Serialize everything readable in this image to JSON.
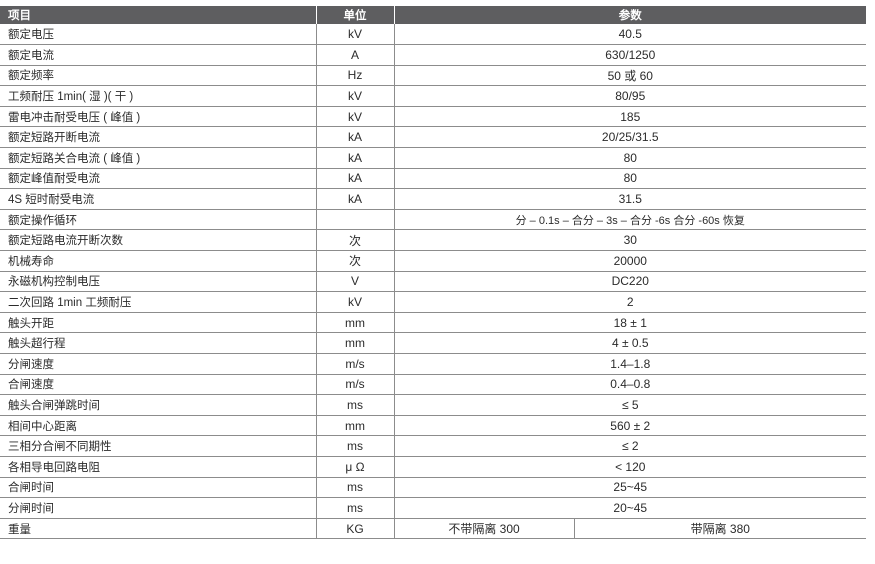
{
  "header": {
    "item": "项目",
    "unit": "单位",
    "param": "参数"
  },
  "rows": [
    {
      "item": "额定电压",
      "unit": "kV",
      "value": "40.5"
    },
    {
      "item": "额定电流",
      "unit": "A",
      "value": "630/1250"
    },
    {
      "item": "额定频率",
      "unit": "Hz",
      "value": "50 或 60"
    },
    {
      "item": "工频耐压 1min( 湿 )( 干 )",
      "unit": "kV",
      "value": "80/95"
    },
    {
      "item": "雷电冲击耐受电压 ( 峰值 )",
      "unit": "kV",
      "value": "185"
    },
    {
      "item": "额定短路开断电流",
      "unit": "kA",
      "value": "20/25/31.5"
    },
    {
      "item": "额定短路关合电流 ( 峰值 )",
      "unit": "kA",
      "value": "80"
    },
    {
      "item": "额定峰值耐受电流",
      "unit": "kA",
      "value": "80"
    },
    {
      "item": "4S 短时耐受电流",
      "unit": "kA",
      "value": "31.5"
    },
    {
      "item": "额定操作循环",
      "unit": "",
      "value": "分 – 0.1s – 合分 – 3s – 合分 -6s 合分 -60s 恢复"
    },
    {
      "item": "额定短路电流开断次数",
      "unit": "次",
      "value": "30"
    },
    {
      "item": "机械寿命",
      "unit": "次",
      "value": "20000"
    },
    {
      "item": "永磁机构控制电压",
      "unit": "V",
      "value": "DC220"
    },
    {
      "item": "二次回路 1min 工频耐压",
      "unit": "kV",
      "value": "2"
    },
    {
      "item": "触头开距",
      "unit": "mm",
      "value": "18 ± 1"
    },
    {
      "item": "触头超行程",
      "unit": "mm",
      "value": "4 ± 0.5"
    },
    {
      "item": "分闸速度",
      "unit": "m/s",
      "value": "1.4–1.8"
    },
    {
      "item": "合闸速度",
      "unit": "m/s",
      "value": "0.4–0.8"
    },
    {
      "item": "触头合闸弹跳时间",
      "unit": "ms",
      "value": "≤ 5"
    },
    {
      "item": "相间中心距离",
      "unit": "mm",
      "value": "560 ± 2"
    },
    {
      "item": "三相分合闸不同期性",
      "unit": "ms",
      "value": "≤ 2"
    },
    {
      "item": "各相导电回路电阻",
      "unit": "μ Ω",
      "value": "< 120"
    },
    {
      "item": "合闸时间",
      "unit": "ms",
      "value": "25~45"
    },
    {
      "item": "分闸时间",
      "unit": "ms",
      "value": "20~45"
    }
  ],
  "weight_row": {
    "item": "重量",
    "unit": "KG",
    "value_without_isolation": "不带隔离 300",
    "value_with_isolation": "带隔离 380"
  }
}
